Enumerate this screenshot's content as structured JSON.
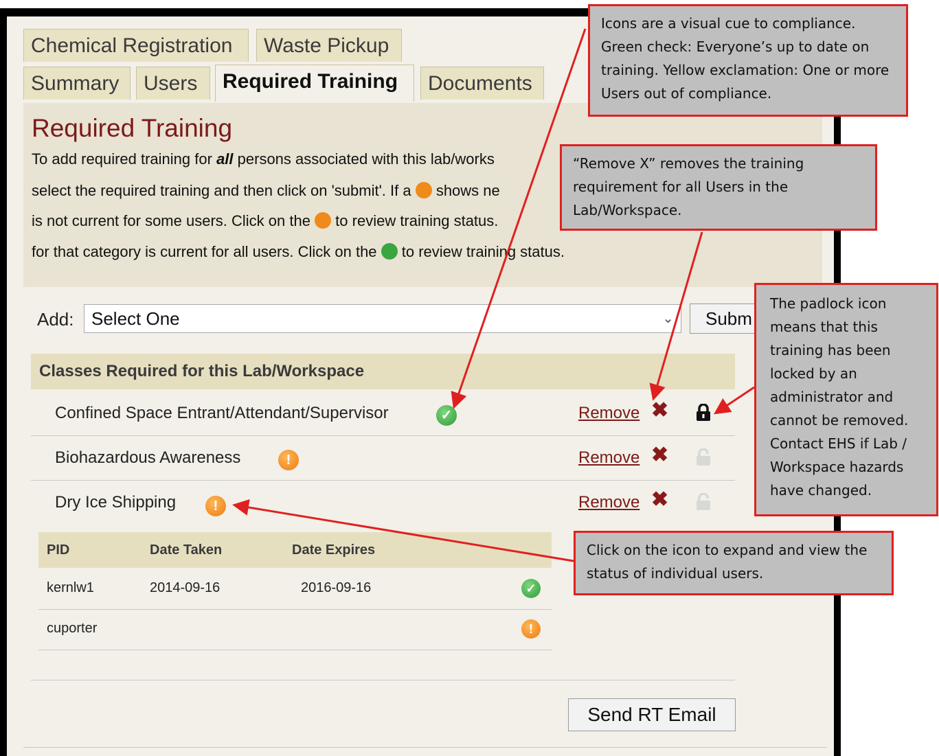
{
  "tabs_row1": [
    {
      "label": "Chemical Registration"
    },
    {
      "label": "Waste Pickup"
    }
  ],
  "tabs_row2": [
    {
      "label": "Summary"
    },
    {
      "label": "Users"
    },
    {
      "label": "Required Training"
    },
    {
      "label": "Documents"
    }
  ],
  "heading": "Required Training",
  "intro": {
    "line1_pre": "To add required training for ",
    "line1_em": "all",
    "line1_post": " persons associated with this lab/works",
    "line2_pre": "select the required training and then click on 'submit'. If a ",
    "line2_post": " shows ne",
    "line3_pre": "is not current for some users. Click on the ",
    "line3_post": " to review training status.",
    "line4_pre": "for that category is current for all users. Click on the ",
    "line4_post": " to review training status."
  },
  "add": {
    "label": "Add:",
    "selected": "Select One",
    "submit": "Subm"
  },
  "section_title": "Classes Required for this Lab/Workspace",
  "classes": [
    {
      "name": "Confined Space Entrant/Attendant/Supervisor",
      "status": "ok",
      "remove": "Remove ",
      "locked": true
    },
    {
      "name": "Biohazardous Awareness",
      "status": "warn",
      "remove": "Remove ",
      "locked": false
    },
    {
      "name": "Dry Ice Shipping",
      "status": "warn",
      "remove": "Remove ",
      "locked": false
    }
  ],
  "sub_table": {
    "headers": [
      "PID",
      "Date Taken",
      "Date Expires"
    ],
    "rows": [
      {
        "pid": "kernlw1",
        "taken": "2014-09-16",
        "expires": "2016-09-16",
        "status": "ok"
      },
      {
        "pid": "cuporter",
        "taken": "",
        "expires": "",
        "status": "warn"
      }
    ]
  },
  "send_button": "Send RT Email",
  "callouts": {
    "icons": "Icons are a visual cue to compliance. Green check: Everyone’s up to date on training. Yellow exclamation:  One or more Users out of compliance.",
    "remove": "“Remove X” removes the training requirement for all Users in the Lab/Workspace.",
    "padlock": "The padlock icon means that this training has been locked by an administrator and cannot be removed. Contact EHS if Lab / Workspace hazards have changed.",
    "expand": "Click on the icon to expand and view the status of individual users."
  },
  "colors": {
    "accent": "#7b1a1a",
    "ok": "#3aa640",
    "warn": "#f08a1a",
    "callout_border": "#e02020"
  }
}
